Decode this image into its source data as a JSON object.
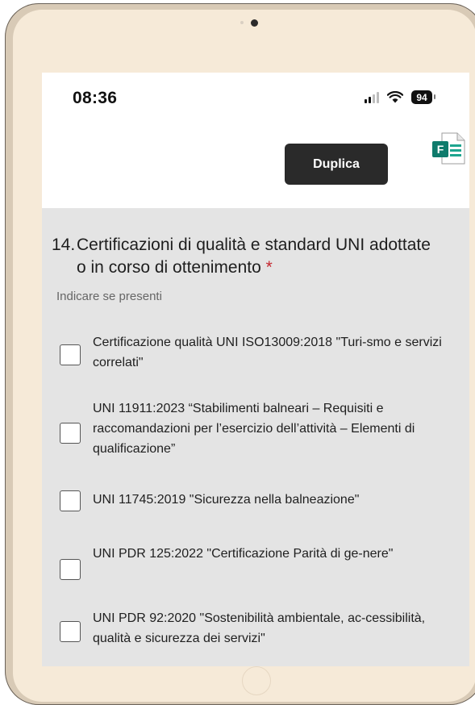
{
  "status_bar": {
    "time": "08:36",
    "battery": "94"
  },
  "header": {
    "duplicate_button": "Duplica",
    "app_icon": "microsoft-forms-icon"
  },
  "question": {
    "number": "14.",
    "title": "Certificazioni di qualità e standard UNI adottate o in corso di ottenimento",
    "required_mark": "*",
    "hint": "Indicare se presenti",
    "options": [
      {
        "label": "Certificazione qualità UNI ISO13009:2018 \"Turi-smo e servizi correlati\"",
        "checked": false
      },
      {
        "label": "UNI 11911:2023 “Stabilimenti balneari – Requisiti e raccomandazioni per l’esercizio dell’attività – Elementi di qualificazione”",
        "checked": false
      },
      {
        "label": "UNI 11745:2019 \"Sicurezza nella balneazione\"",
        "checked": false
      },
      {
        "label": "UNI PDR 125:2022 \"Certificazione Parità di ge-nere\"",
        "checked": false
      },
      {
        "label": "UNI PDR 92:2020 \"Sostenibilità ambientale, ac-cessibilità, qualità e sicurezza dei servizi\"",
        "checked": false
      }
    ]
  },
  "colors": {
    "button_bg": "#2a2a2a",
    "required": "#c4262e",
    "content_bg": "#e4e4e4",
    "frame": "#f6ead8"
  }
}
